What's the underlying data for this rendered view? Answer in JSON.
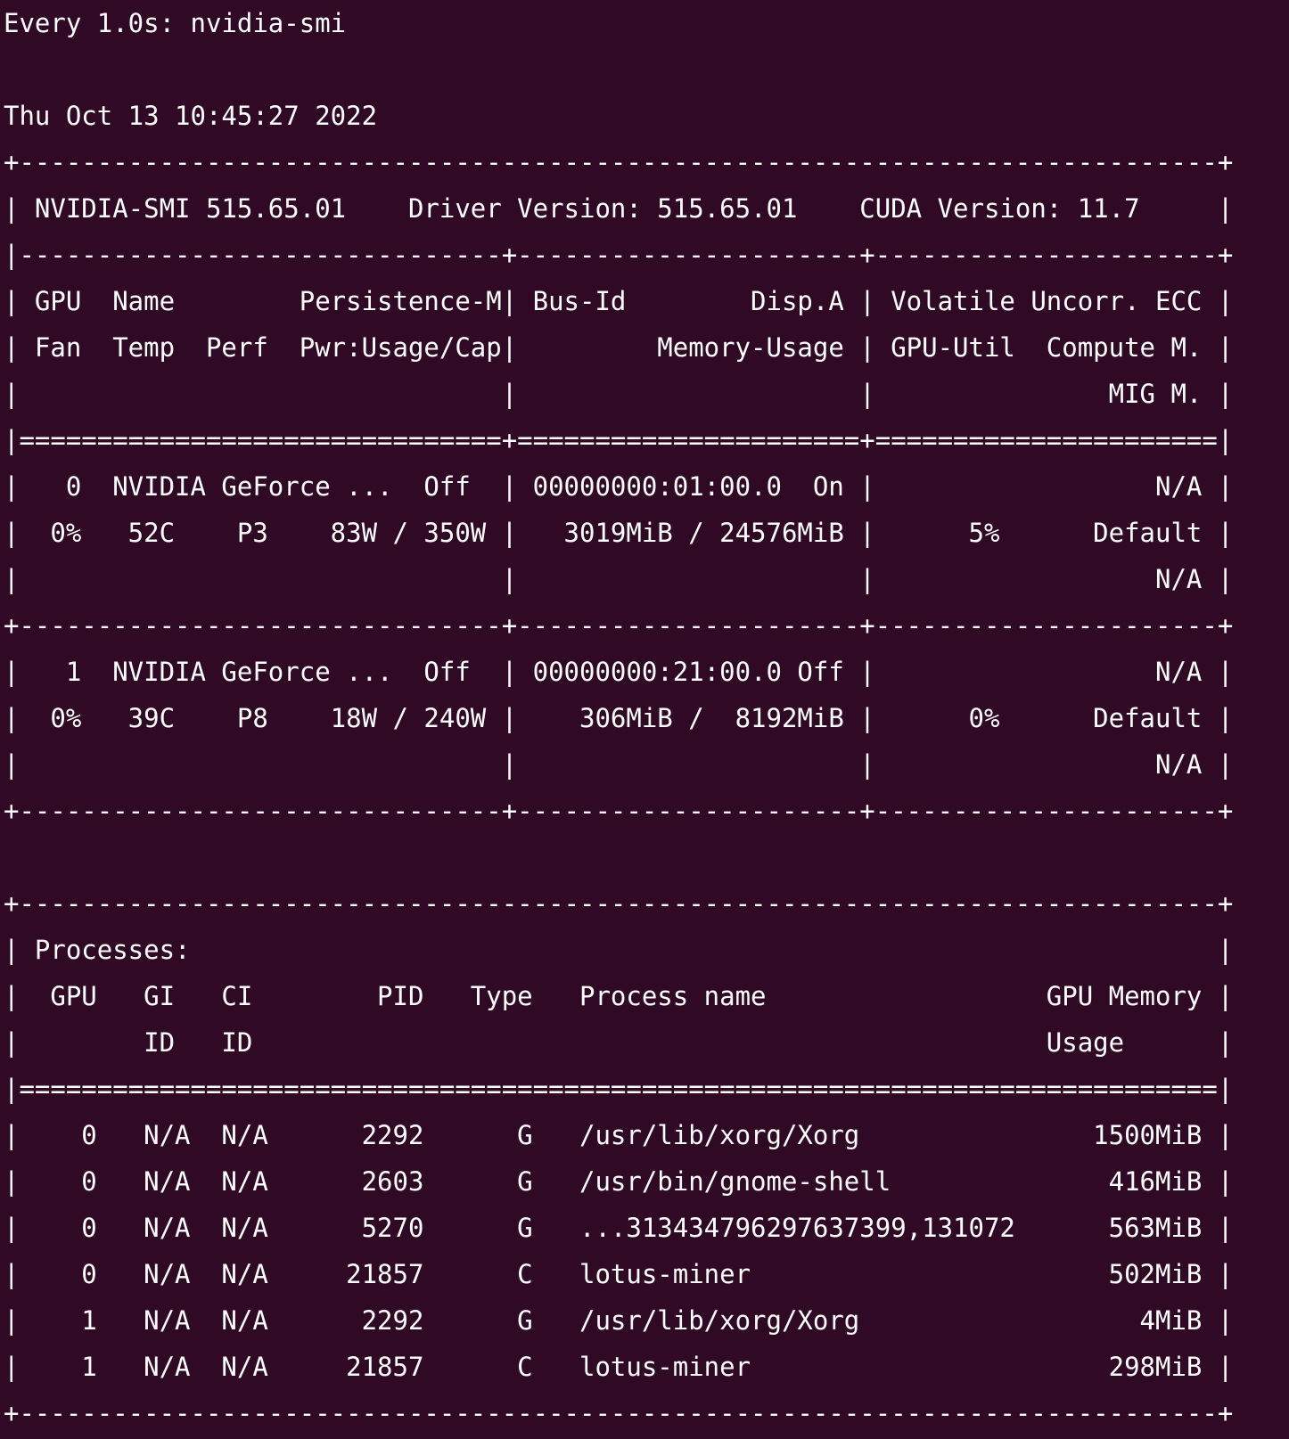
{
  "command_header": "Every 1.0s: nvidia-smi",
  "timestamp": "Thu Oct 13 10:45:27 2022",
  "smi": {
    "border_top": "+-----------------------------------------------------------------------------+",
    "version_line": "| NVIDIA-SMI 515.65.01    Driver Version: 515.65.01    CUDA Version: 11.7     |",
    "sep_top": "|-------------------------------+----------------------+----------------------+",
    "header_lines": [
      "| GPU  Name        Persistence-M| Bus-Id        Disp.A | Volatile Uncorr. ECC |",
      "| Fan  Temp  Perf  Pwr:Usage/Cap|         Memory-Usage | GPU-Util  Compute M. |",
      "|                               |                      |               MIG M. |"
    ],
    "sep_double": "|===============================+======================+======================|",
    "gpus": [
      {
        "lines": [
          "|   0  NVIDIA GeForce ...  Off  | 00000000:01:00.0  On |                  N/A |",
          "|  0%   52C    P3    83W / 350W |   3019MiB / 24576MiB |      5%      Default |",
          "|                               |                      |                  N/A |"
        ],
        "separator": "+-------------------------------+----------------------+----------------------+"
      },
      {
        "lines": [
          "|   1  NVIDIA GeForce ...  Off  | 00000000:21:00.0 Off |                  N/A |",
          "|  0%   39C    P8    18W / 240W |    306MiB /  8192MiB |      0%      Default |",
          "|                               |                      |                  N/A |"
        ],
        "separator": "+-------------------------------+----------------------+----------------------+"
      }
    ]
  },
  "processes": {
    "border_top": "+-----------------------------------------------------------------------------+",
    "title_line": "| Processes:                                                                  |",
    "header_lines": [
      "|  GPU   GI   CI        PID   Type   Process name                  GPU Memory |",
      "|        ID   ID                                                   Usage      |"
    ],
    "sep_double": "|=============================================================================|",
    "rows": [
      "|    0   N/A  N/A      2292      G   /usr/lib/xorg/Xorg               1500MiB |",
      "|    0   N/A  N/A      2603      G   /usr/bin/gnome-shell              416MiB |",
      "|    0   N/A  N/A      5270      G   ...313434796297637399,131072      563MiB |",
      "|    0   N/A  N/A     21857      C   lotus-miner                       502MiB |",
      "|    1   N/A  N/A      2292      G   /usr/lib/xorg/Xorg                  4MiB |",
      "|    1   N/A  N/A     21857      C   lotus-miner                       298MiB |"
    ],
    "border_bottom": "+-----------------------------------------------------------------------------+"
  }
}
